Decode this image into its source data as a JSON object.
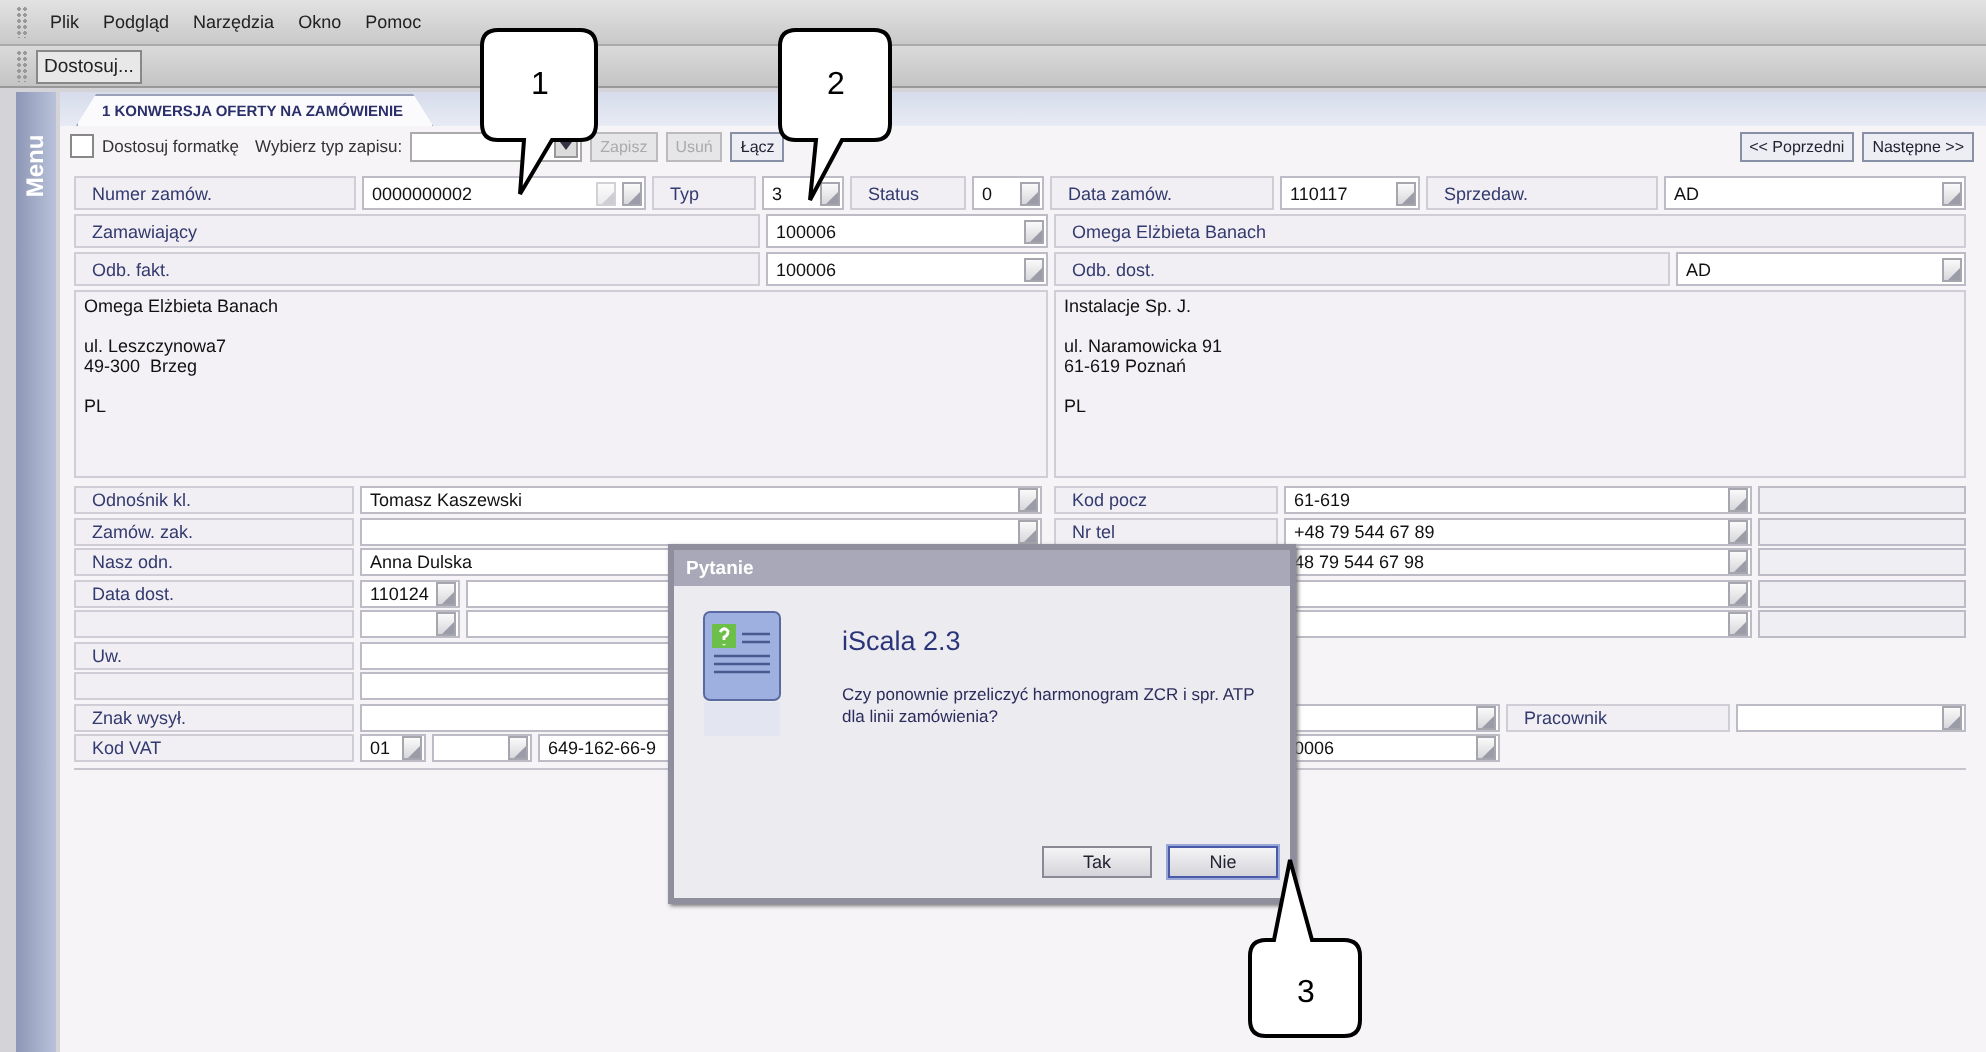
{
  "menu": [
    "Plik",
    "Podgląd",
    "Narzędzia",
    "Okno",
    "Pomoc"
  ],
  "toolbar": {
    "button": "Dostosuj..."
  },
  "sidebar": {
    "label": "Menu"
  },
  "tab": {
    "title": "1 KONWERSJA OFERTY NA ZAMÓWIENIE"
  },
  "actions": {
    "customize": {
      "label": "Dostosuj formatkę",
      "checked": false
    },
    "record_type": {
      "label": "Wybierz typ zapisu:"
    },
    "buttons": [
      {
        "label": "Zapisz",
        "disabled": true
      },
      {
        "label": "Usuń",
        "disabled": true
      },
      {
        "label": "Łącz",
        "disabled": false
      }
    ],
    "nav": [
      "<< Poprzedni",
      "Następne >>"
    ]
  },
  "header": [
    [
      {
        "kind": "label",
        "text": "Numer zamów."
      },
      {
        "kind": "field2",
        "value": "0000000002"
      },
      {
        "kind": "label",
        "text": "Typ"
      },
      {
        "kind": "field",
        "value": "3"
      },
      {
        "kind": "label",
        "text": "Status"
      },
      {
        "kind": "field",
        "value": "0"
      },
      {
        "kind": "label",
        "text": "Data zamów."
      },
      {
        "kind": "field",
        "value": "110117"
      },
      {
        "kind": "label",
        "text": "Sprzedaw."
      },
      {
        "kind": "field",
        "value": "AD"
      }
    ],
    [
      {
        "kind": "label",
        "text": "Zamawiający"
      },
      {
        "kind": "field",
        "value": "100006"
      },
      {
        "kind": "info",
        "text": "Omega Elżbieta Banach"
      }
    ],
    [
      {
        "kind": "label",
        "text": "Odb. fakt."
      },
      {
        "kind": "field",
        "value": "100006"
      },
      {
        "kind": "label",
        "text": "Odb. dost."
      },
      {
        "kind": "field",
        "value": "AD"
      }
    ]
  ],
  "addresses": [
    {
      "blocks": [
        [
          "Omega Elżbieta Banach"
        ],
        [
          "ul. Leszczynowa7",
          "49-300  Brzeg"
        ],
        [
          "PL"
        ]
      ]
    },
    {
      "blocks": [
        [
          "Instalacje Sp. J."
        ],
        [
          "ul. Naramowicka 91",
          "61-619 Poznań"
        ],
        [
          "PL"
        ]
      ]
    }
  ],
  "details_left": [
    {
      "label": "Odnośnik kl.",
      "fields": [
        {
          "kind": "wide",
          "value": "Tomasz Kaszewski"
        }
      ]
    },
    {
      "label": "Zamów. zak.",
      "fields": [
        {
          "kind": "wide"
        }
      ]
    },
    {
      "label": "Nasz odn.",
      "fields": [
        {
          "kind": "plain",
          "value": "Anna Dulska"
        }
      ]
    },
    {
      "label": "Data dost.",
      "fields": [
        {
          "kind": "short",
          "value": "110124"
        },
        {
          "kind": "plain"
        }
      ]
    },
    {
      "fields": [
        {
          "kind": "short"
        },
        {
          "kind": "plain"
        }
      ]
    },
    {
      "label": "Uw.",
      "fields": [
        {
          "kind": "plain"
        }
      ]
    },
    {
      "fields": [
        {
          "kind": "plain"
        }
      ]
    },
    {
      "label": "Znak wysył.",
      "fields": [
        {
          "kind": "plain"
        }
      ]
    },
    {
      "label": "Kod VAT",
      "fields": [
        {
          "kind": "tiny",
          "value": "01"
        },
        {
          "kind": "short"
        },
        {
          "kind": "plain",
          "value": "649-162-66-9"
        }
      ]
    }
  ],
  "details_right": [
    {
      "kind": "row",
      "label": "Kod pocz",
      "fields": [
        {
          "kind": "wide",
          "value": "61-619"
        },
        {
          "kind": "extra"
        }
      ]
    },
    {
      "kind": "row",
      "label": "Nr tel",
      "fields": [
        {
          "kind": "wide",
          "value": "+48 79 544 67 89"
        },
        {
          "kind": "extra"
        }
      ]
    },
    {
      "kind": "row",
      "fields": [
        {
          "kind": "wide",
          "value": "48 79 544 67 98"
        },
        {
          "kind": "extra"
        }
      ]
    },
    {
      "kind": "row",
      "fields": [
        {
          "kind": "wide"
        },
        {
          "kind": "extra"
        }
      ]
    },
    {
      "kind": "row",
      "fields": [
        {
          "kind": "wide"
        },
        {
          "kind": "extra"
        }
      ]
    },
    {
      "kind": "spacer"
    },
    {
      "kind": "spacer"
    },
    {
      "kind": "row",
      "fields": [
        {
          "kind": "mid"
        },
        {
          "kind": "label",
          "text": "Pracownik"
        },
        {
          "kind": "select"
        }
      ]
    },
    {
      "kind": "row",
      "fields": [
        {
          "kind": "mid",
          "value": "0006"
        }
      ]
    }
  ],
  "dialog": {
    "title": "Pytanie",
    "heading": "iScala 2.3",
    "message": "Czy ponownie przeliczyć harmonogram ZCR i spr. ATP dla linii zamówienia?",
    "buttons": [
      {
        "label": "Tak",
        "focused": false
      },
      {
        "label": "Nie",
        "focused": true
      }
    ]
  },
  "callouts": [
    "1",
    "2",
    "3"
  ]
}
